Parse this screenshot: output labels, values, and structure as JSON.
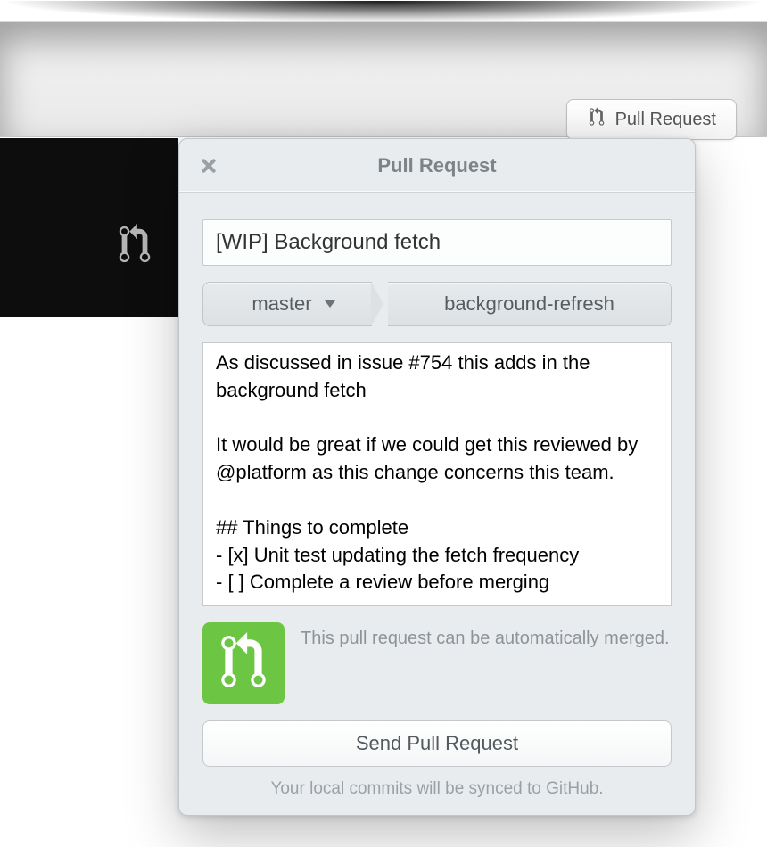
{
  "toolbar": {
    "pr_button_label": "Pull Request"
  },
  "popover": {
    "title": "Pull Request",
    "pr_title_value": "[WIP] Background fetch",
    "base_branch": "master",
    "head_branch": "background-refresh",
    "description": "As discussed in issue #754 this adds in the background fetch\n\nIt would be great if we could get this reviewed by @platform as this change concerns this team.\n\n## Things to complete\n- [x] Unit test updating the fetch frequency\n- [ ] Complete a review before merging",
    "merge_status": "This pull request can be automatically merged.",
    "send_label": "Send Pull Request",
    "sync_note": "Your local commits will be synced to GitHub."
  },
  "colors": {
    "merge_ok": "#6cc644"
  }
}
